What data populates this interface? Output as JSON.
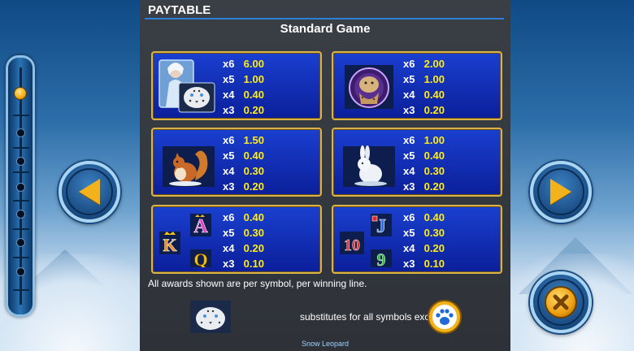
{
  "header": {
    "title": "PAYTABLE",
    "subtitle": "Standard Game"
  },
  "cards": [
    {
      "symbol": "snow-queen-leopard-icon",
      "pays": [
        {
          "m": "x6",
          "v": "6.00"
        },
        {
          "m": "x5",
          "v": "1.00"
        },
        {
          "m": "x4",
          "v": "0.40"
        },
        {
          "m": "x3",
          "v": "0.20"
        }
      ]
    },
    {
      "symbol": "leopard-jewel-icon",
      "pays": [
        {
          "m": "x6",
          "v": "2.00"
        },
        {
          "m": "x5",
          "v": "1.00"
        },
        {
          "m": "x4",
          "v": "0.40"
        },
        {
          "m": "x3",
          "v": "0.20"
        }
      ]
    },
    {
      "symbol": "squirrel-icon",
      "pays": [
        {
          "m": "x6",
          "v": "1.50"
        },
        {
          "m": "x5",
          "v": "0.40"
        },
        {
          "m": "x4",
          "v": "0.30"
        },
        {
          "m": "x3",
          "v": "0.20"
        }
      ]
    },
    {
      "symbol": "rabbit-icon",
      "pays": [
        {
          "m": "x6",
          "v": "1.00"
        },
        {
          "m": "x5",
          "v": "0.40"
        },
        {
          "m": "x4",
          "v": "0.30"
        },
        {
          "m": "x3",
          "v": "0.20"
        }
      ]
    },
    {
      "symbol": "royals-a-k-q-icon",
      "letters": [
        "A",
        "K",
        "Q"
      ],
      "pays": [
        {
          "m": "x6",
          "v": "0.40"
        },
        {
          "m": "x5",
          "v": "0.30"
        },
        {
          "m": "x4",
          "v": "0.20"
        },
        {
          "m": "x3",
          "v": "0.10"
        }
      ]
    },
    {
      "symbol": "royals-j-10-9-icon",
      "letters": [
        "J",
        "10",
        "9"
      ],
      "pays": [
        {
          "m": "x6",
          "v": "0.40"
        },
        {
          "m": "x5",
          "v": "0.30"
        },
        {
          "m": "x4",
          "v": "0.20"
        },
        {
          "m": "x3",
          "v": "0.10"
        }
      ]
    }
  ],
  "note": "All awards shown are per symbol, per winning line.",
  "wild": {
    "text": "substitutes for all symbols except",
    "label": "Snow Leopard"
  },
  "colors": {
    "card_border": "#d9b24a",
    "pay_value": "#ffec1a",
    "rule": "#2b7fd8",
    "button_gold": "#f2b21c"
  }
}
